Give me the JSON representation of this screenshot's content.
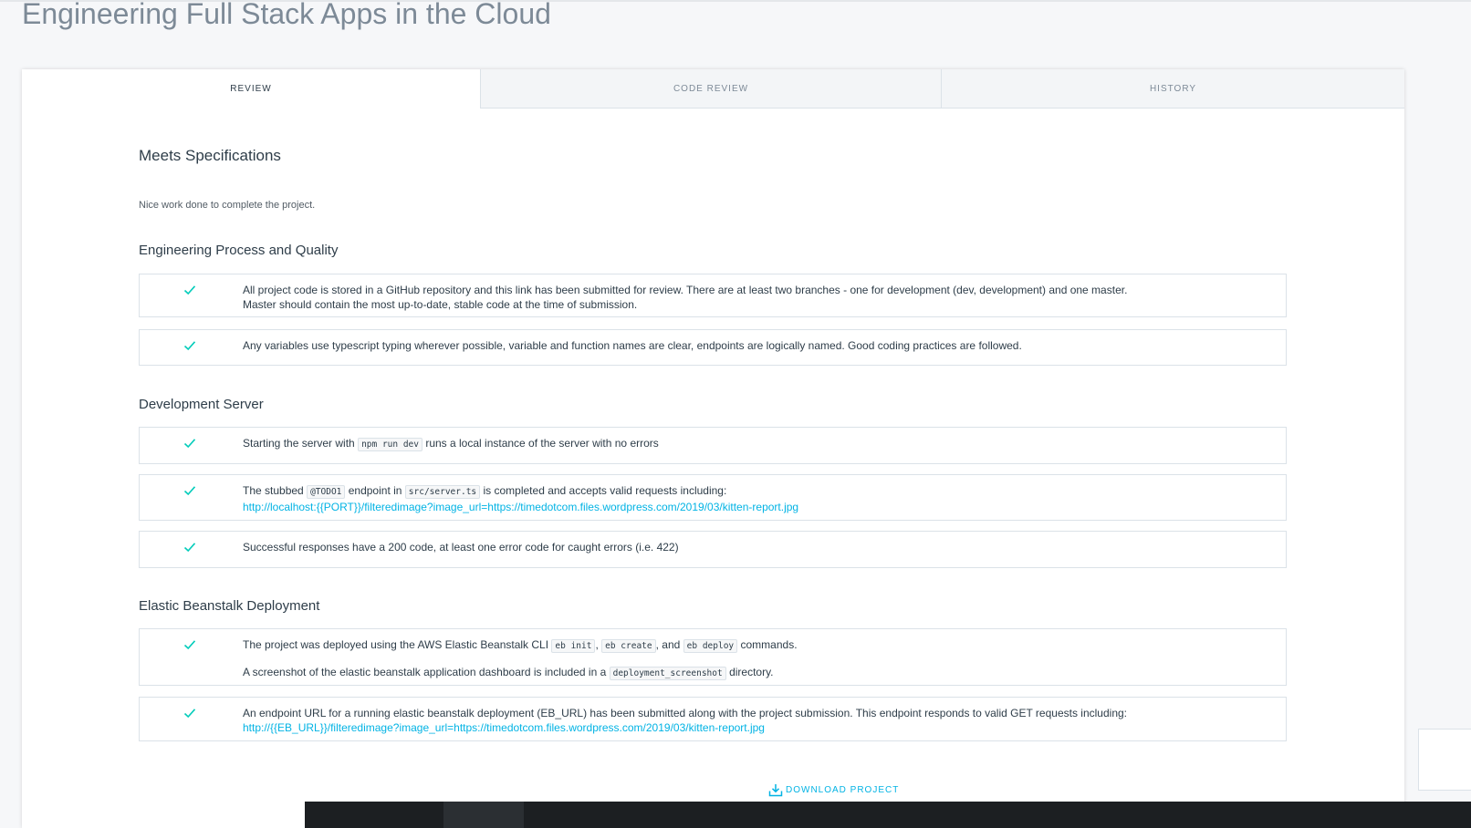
{
  "page": {
    "title": "Engineering Full Stack Apps in the Cloud"
  },
  "tabs": [
    {
      "label": "REVIEW",
      "active": true
    },
    {
      "label": "CODE REVIEW",
      "active": false
    },
    {
      "label": "HISTORY",
      "active": false
    }
  ],
  "review": {
    "status": "Meets Specifications",
    "note": "Nice work done to complete the project.",
    "check_icon": "checkmark-icon",
    "check_color": "#02ccba",
    "link_color": "#02b3e4",
    "sections": [
      {
        "title": "Engineering Process and Quality",
        "items": [
          {
            "line1": "All project code is stored in a GitHub repository and this link has been submitted for review. There are at least two branches - one for development (dev, development) and one master.",
            "line2": "Master should contain the most up-to-date, stable code at the time of submission."
          },
          {
            "text": "Any variables use typescript typing wherever possible, variable and function names are clear, endpoints are logically named. Good coding practices are followed."
          }
        ]
      },
      {
        "title": "Development Server",
        "items": [
          {
            "before": "Starting the server with",
            "code": "npm run dev",
            "after": "runs a local instance of the server with no errors"
          },
          {
            "t1": "The stubbed",
            "code1": "@TODO1",
            "t2": "endpoint in",
            "code2": "src/server.ts",
            "t3": "is completed and accepts valid requests including:",
            "link": "http://localhost:{{PORT}}/filteredimage?image_url=https://timedotcom.files.wordpress.com/2019/03/kitten-report.jpg"
          },
          {
            "text": "Successful responses have a 200 code, at least one error code for caught errors (i.e. 422)"
          }
        ]
      },
      {
        "title": "Elastic Beanstalk Deployment",
        "items": [
          {
            "t1": "The project was deployed using the AWS Elastic Beanstalk CLI",
            "code1": "eb init",
            "sep1": ",",
            "code2": "eb create",
            "sep2": ", and",
            "code3": "eb deploy",
            "t2": "commands.",
            "p2_before": "A screenshot of the elastic beanstalk application dashboard is included in a",
            "p2_code": "deployment_screenshot",
            "p2_after": "directory."
          },
          {
            "text": "An endpoint URL for a running elastic beanstalk deployment (EB_URL) has been submitted along with the project submission. This endpoint responds to valid GET requests including:",
            "link": "http://{{EB_URL}}/filteredimage?image_url=https://timedotcom.files.wordpress.com/2019/03/kitten-report.jpg"
          }
        ]
      }
    ],
    "download_label": "DOWNLOAD PROJECT",
    "download_icon": "download-icon"
  }
}
